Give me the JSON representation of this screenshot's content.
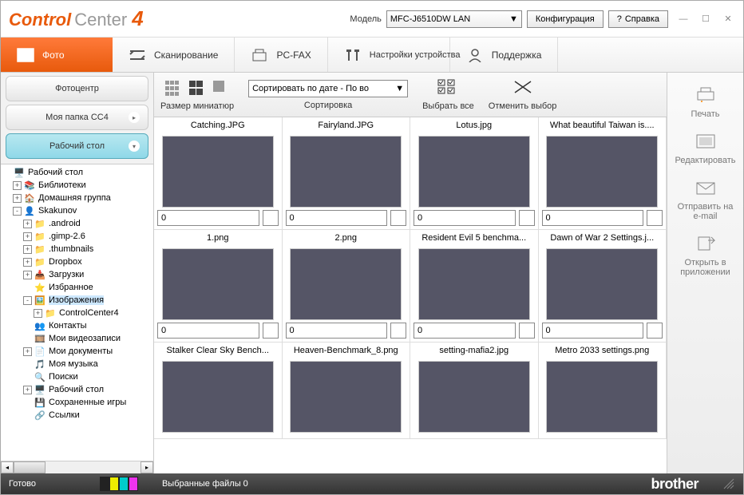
{
  "logo": {
    "part1": "Control",
    "part2": "Center",
    "part3": "4"
  },
  "header": {
    "model_label": "Модель",
    "model_value": "MFC-J6510DW LAN",
    "config": "Конфигурация",
    "help": "Справка",
    "help_q": "?"
  },
  "tabs": [
    {
      "id": "photo",
      "label": "Фото"
    },
    {
      "id": "scan",
      "label": "Сканирование"
    },
    {
      "id": "pcfax",
      "label": "PC-FAX"
    },
    {
      "id": "settings",
      "label": "Настройки устройства"
    },
    {
      "id": "support",
      "label": "Поддержка"
    }
  ],
  "sidebar": {
    "btn1": "Фотоцентр",
    "btn2": "Моя папка CC4",
    "btn3": "Рабочий стол"
  },
  "tree": [
    {
      "depth": 0,
      "ex": "",
      "icon": "pc",
      "label": "Рабочий стол"
    },
    {
      "depth": 1,
      "ex": "+",
      "icon": "lib",
      "label": "Библиотеки"
    },
    {
      "depth": 1,
      "ex": "+",
      "icon": "home",
      "label": "Домашняя группа"
    },
    {
      "depth": 1,
      "ex": "-",
      "icon": "user",
      "label": "Skakunov"
    },
    {
      "depth": 2,
      "ex": "+",
      "icon": "fold",
      "label": ".android"
    },
    {
      "depth": 2,
      "ex": "+",
      "icon": "fold",
      "label": ".gimp-2.6"
    },
    {
      "depth": 2,
      "ex": "+",
      "icon": "fold",
      "label": ".thumbnails"
    },
    {
      "depth": 2,
      "ex": "+",
      "icon": "fold",
      "label": "Dropbox"
    },
    {
      "depth": 2,
      "ex": "+",
      "icon": "dl",
      "label": "Загрузки"
    },
    {
      "depth": 2,
      "ex": "",
      "icon": "fav",
      "label": "Избранное"
    },
    {
      "depth": 2,
      "ex": "-",
      "icon": "pic",
      "label": "Изображения",
      "sel": true
    },
    {
      "depth": 3,
      "ex": "+",
      "icon": "fold",
      "label": "ControlCenter4"
    },
    {
      "depth": 2,
      "ex": "",
      "icon": "cont",
      "label": "Контакты"
    },
    {
      "depth": 2,
      "ex": "",
      "icon": "vid",
      "label": "Мои видеозаписи"
    },
    {
      "depth": 2,
      "ex": "+",
      "icon": "doc",
      "label": "Мои документы"
    },
    {
      "depth": 2,
      "ex": "",
      "icon": "mus",
      "label": "Моя музыка"
    },
    {
      "depth": 2,
      "ex": "",
      "icon": "srch",
      "label": "Поиски"
    },
    {
      "depth": 2,
      "ex": "+",
      "icon": "desk",
      "label": "Рабочий стол"
    },
    {
      "depth": 2,
      "ex": "",
      "icon": "save",
      "label": "Сохраненные игры"
    },
    {
      "depth": 2,
      "ex": "",
      "icon": "link",
      "label": "Ссылки"
    }
  ],
  "toolbar": {
    "thumb_label": "Размер миниатюр",
    "sort_label": "Сортировка",
    "sort_value": "Сортировать по дате - По во",
    "selectall": "Выбрать все",
    "deselect": "Отменить выбор"
  },
  "thumbs": [
    {
      "name": "Catching.JPG",
      "cls": "fimg1",
      "val": "0"
    },
    {
      "name": "Fairyland.JPG",
      "cls": "fimg2",
      "val": "0"
    },
    {
      "name": "Lotus.jpg",
      "cls": "fimg3",
      "val": "0"
    },
    {
      "name": "What beautiful Taiwan is....",
      "cls": "fimg4",
      "val": "0"
    },
    {
      "name": "1.png",
      "cls": "fimg5",
      "val": "0"
    },
    {
      "name": "2.png",
      "cls": "fimg6",
      "val": "0"
    },
    {
      "name": "Resident Evil 5 benchma...",
      "cls": "fimg7",
      "val": "0"
    },
    {
      "name": "Dawn of War 2 Settings.j...",
      "cls": "fimg8",
      "val": "0"
    },
    {
      "name": "Stalker Clear Sky Bench...",
      "cls": "fimg9",
      "val": ""
    },
    {
      "name": "Heaven-Benchmark_8.png",
      "cls": "fimg10",
      "val": ""
    },
    {
      "name": "setting-mafia2.jpg",
      "cls": "fimg11",
      "val": ""
    },
    {
      "name": "Metro 2033 settings.png",
      "cls": "fimg12",
      "val": ""
    }
  ],
  "actions": {
    "print": "Печать",
    "edit": "Редактировать",
    "email": "Отправить на e-mail",
    "open": "Открыть в приложении"
  },
  "status": {
    "ready": "Готово",
    "selected": "Выбранные файлы 0",
    "brand": "brother"
  }
}
